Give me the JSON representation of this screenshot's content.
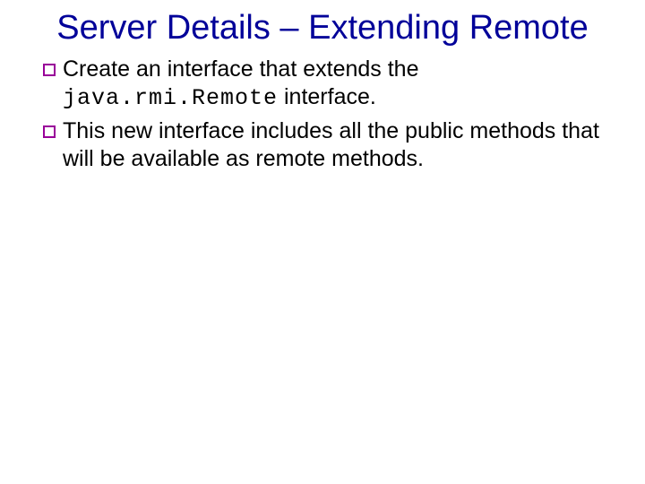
{
  "slide": {
    "title": "Server Details – Extending Remote",
    "bullets": [
      {
        "pre": "Create an interface that extends the ",
        "code": "java.rmi.Remote",
        "post": " interface."
      },
      {
        "pre": "This new interface includes all the public methods that will be available as remote methods.",
        "code": "",
        "post": ""
      }
    ]
  },
  "colors": {
    "title": "#000099",
    "bullet_border": "#990099",
    "text": "#000000"
  }
}
